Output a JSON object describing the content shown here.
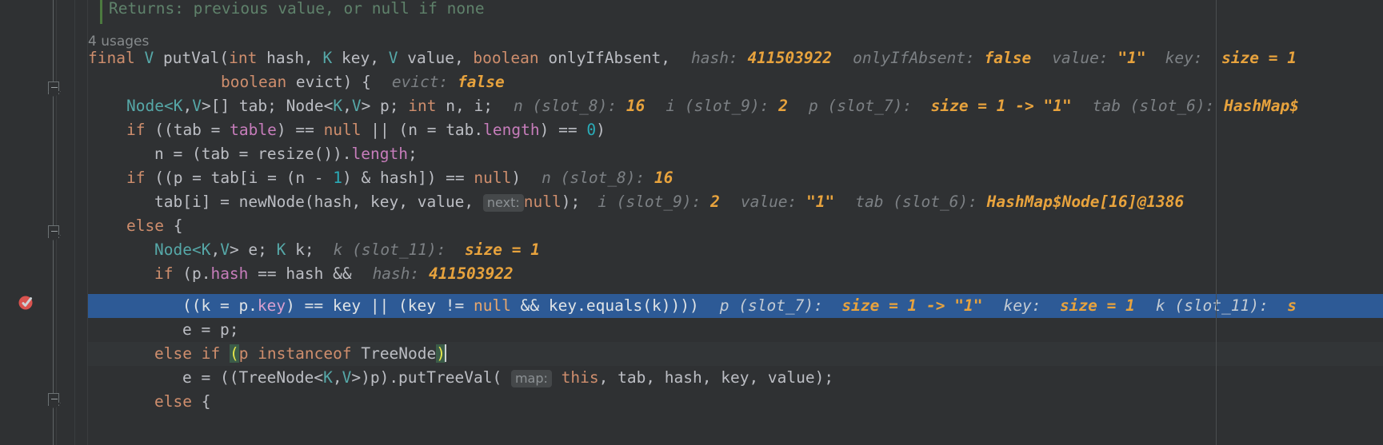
{
  "editor": {
    "theme": "darcula",
    "background": "#2f3133",
    "exec_line_color": "#2d5a96",
    "accent_value_color": "#e8a33d",
    "keyword_color": "#cf8e6d",
    "comment_color": "#5f826b",
    "margin_guide_x": "1520"
  },
  "gutter": {
    "breakpoint_icon": "breakpoint-verified-icon",
    "fold_markers": [
      "fold-collapse-icon",
      "fold-collapse-icon"
    ]
  },
  "usages_label": "4 usages",
  "code": {
    "line_comment_returns": "Returns: previous value, or null if none",
    "l1": {
      "kw_final": "final",
      "type_v": "V",
      "fn": " putVal(",
      "kw_int": "int",
      "p_hash": " hash, ",
      "type_k": "K",
      "p_key": " key, ",
      "type_v2": "V",
      "p_value": " value, ",
      "kw_boolean": "boolean",
      "p_onlyifabsent": " onlyIfAbsent,",
      "hint1_label": "hash:",
      "hint1_val": "411503922",
      "hint2_label": "onlyIfAbsent:",
      "hint2_val": "false",
      "hint3_label": "value:",
      "hint3_val": "\"1\"",
      "hint4_label": "key:",
      "hint4_val": "size = 1"
    },
    "l2": {
      "kw_boolean": "boolean",
      "rest": " evict) {",
      "hint_label": "evict:",
      "hint_val": "false"
    },
    "l3": {
      "type_node": "Node<",
      "type_k": "K",
      "comma1": ",",
      "type_v": "V",
      "gt1": ">[] tab; Node<",
      "type_k2": "K",
      "comma2": ",",
      "type_v2": "V",
      "gt2": "> p; ",
      "kw_int": "int",
      "rest": " n, i;",
      "hint1_label": "n (slot_8):",
      "hint1_val": "16",
      "hint2_label": "i (slot_9):",
      "hint2_val": "2",
      "hint3_label": "p (slot_7):",
      "hint3_val": "size = 1 -> \"1\"",
      "hint4_label": "tab (slot_6):",
      "hint4_val": "HashMap$"
    },
    "l4": {
      "kw_if": "if",
      "seg1": " ((tab = ",
      "field_table": "table",
      "seg2": ") == ",
      "kw_null": "null",
      "seg3": " || (n = tab.",
      "field_length": "length",
      "seg4": ") == ",
      "num0": "0",
      "seg5": ")"
    },
    "l5": {
      "seg1": "n = (tab = resize()).",
      "field_length": "length",
      "seg2": ";"
    },
    "l6": {
      "kw_if": "if",
      "seg1": " ((p = tab[i = (n - ",
      "num1": "1",
      "seg2": ") & hash]) == ",
      "kw_null": "null",
      "seg3": ")",
      "hint_label": "n (slot_8):",
      "hint_val": "16"
    },
    "l7": {
      "seg1": "tab[i] = newNode(hash, key, value, ",
      "inlay": "next:",
      "kw_null": "null",
      "seg2": ");",
      "hint1_label": "i (slot_9):",
      "hint1_val": "2",
      "hint2_label": "value:",
      "hint2_val": "\"1\"",
      "hint3_label": "tab (slot_6):",
      "hint3_val": "HashMap$Node[16]@1386"
    },
    "l8": {
      "kw_else": "else",
      "brace": " {"
    },
    "l9": {
      "type_node": "Node<",
      "type_k": "K",
      "comma": ",",
      "type_v": "V",
      "seg1": "> e; ",
      "type_k2": "K",
      "seg2": " k;",
      "hint_label": "k (slot_11):",
      "hint_val": "size = 1"
    },
    "l10": {
      "kw_if": "if",
      "seg1": " (p.",
      "field_hash": "hash",
      "seg2": " == hash &&",
      "hint_label": "hash:",
      "hint_val": "411503922"
    },
    "l11_exec": {
      "seg1": "((k = p.",
      "field_key": "key",
      "seg2": ") == key || (key != ",
      "kw_null": "null",
      "seg3": " && key.equals(k))))",
      "hint1_label": "p (slot_7):",
      "hint1_val": "size = 1 -> \"1\"",
      "hint2_label": "key:",
      "hint2_val": "size = 1",
      "hint3_label": "k (slot_11):",
      "hint3_val": "s"
    },
    "l12": {
      "text": "e = p;"
    },
    "l13": {
      "kw_else": "else",
      "kw_if": " if",
      "space": " ",
      "open_paren": "(",
      "seg1": "p ",
      "kw_instanceof": "instanceof",
      "seg2": " TreeNode",
      "close_paren": ")"
    },
    "l14": {
      "seg1": "e = ((TreeNode<",
      "type_k": "K",
      "comma": ",",
      "type_v": "V",
      "seg2": ">)p).putTreeVal( ",
      "inlay": "map:",
      "kw_this": "this",
      "seg3": ", tab, hash, key, value);"
    },
    "l15": {
      "kw_else": "else",
      "brace": " {"
    }
  }
}
